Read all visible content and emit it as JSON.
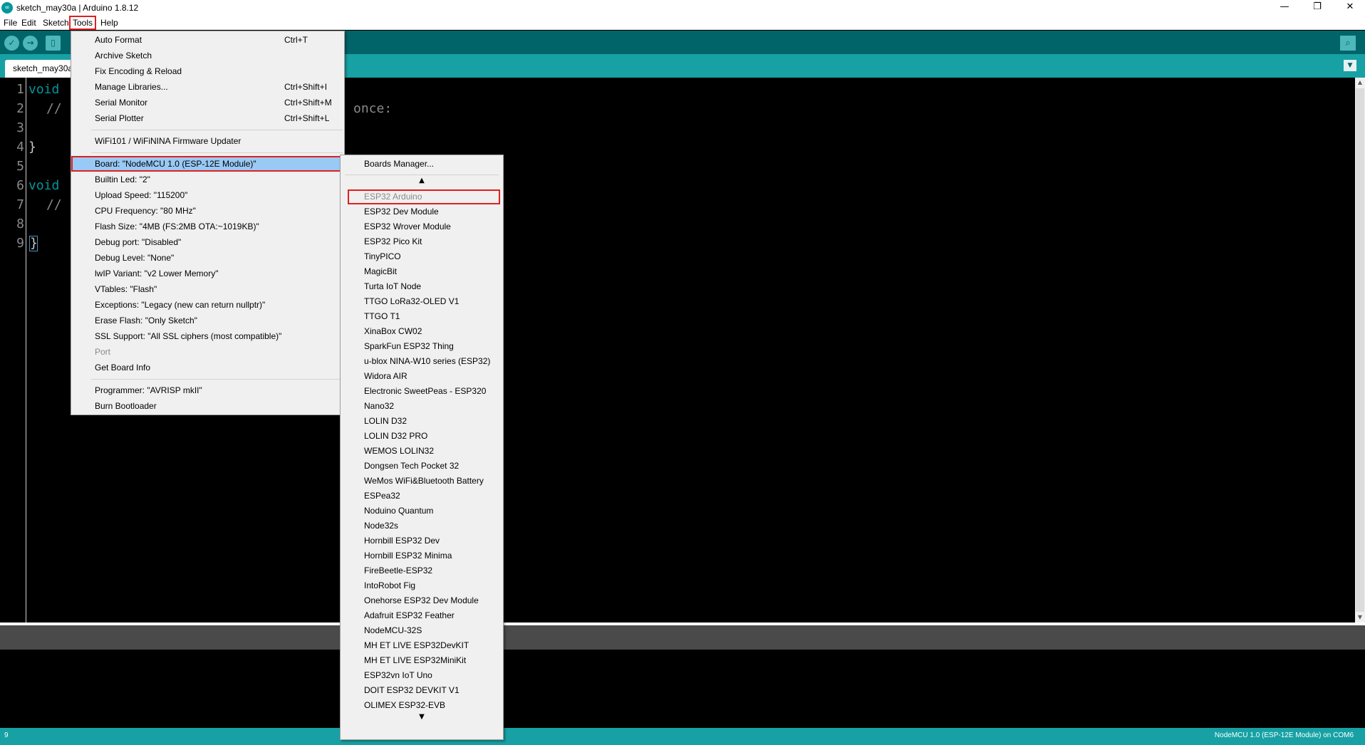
{
  "window": {
    "title": "sketch_may30a | Arduino 1.8.12",
    "logo_glyph": "∞",
    "controls": {
      "minimize": "—",
      "maximize": "❐",
      "close": "✕"
    }
  },
  "menubar": [
    "File",
    "Edit",
    "Sketch",
    "Tools",
    "Help"
  ],
  "toolbar": {
    "verify_icon": "✓",
    "upload_icon": "→",
    "new_icon": "▯",
    "serial_monitor_icon": "⌕"
  },
  "tab": {
    "name": "sketch_may30a",
    "menu_icon": "▼"
  },
  "editor": {
    "line_numbers": [
      "1",
      "2",
      "3",
      "4",
      "5",
      "6",
      "7",
      "8",
      "9"
    ],
    "lines": {
      "l1": "void",
      "l2": "//",
      "l2_tail": "once:",
      "l4": "}",
      "l6": "void",
      "l7": "//",
      "l9": "}"
    }
  },
  "tools_menu": {
    "items": [
      {
        "label": "Auto Format",
        "shortcut": "Ctrl+T"
      },
      {
        "label": "Archive Sketch",
        "shortcut": ""
      },
      {
        "label": "Fix Encoding & Reload",
        "shortcut": ""
      },
      {
        "label": "Manage Libraries...",
        "shortcut": "Ctrl+Shift+I"
      },
      {
        "label": "Serial Monitor",
        "shortcut": "Ctrl+Shift+M"
      },
      {
        "label": "Serial Plotter",
        "shortcut": "Ctrl+Shift+L"
      },
      {
        "label": "WiFi101 / WiFiNINA Firmware Updater",
        "shortcut": ""
      },
      {
        "label": "Board: \"NodeMCU 1.0 (ESP-12E Module)\"",
        "shortcut": ""
      },
      {
        "label": "Builtin Led: \"2\"",
        "shortcut": ""
      },
      {
        "label": "Upload Speed: \"115200\"",
        "shortcut": ""
      },
      {
        "label": "CPU Frequency: \"80 MHz\"",
        "shortcut": ""
      },
      {
        "label": "Flash Size: \"4MB (FS:2MB OTA:~1019KB)\"",
        "shortcut": ""
      },
      {
        "label": "Debug port: \"Disabled\"",
        "shortcut": ""
      },
      {
        "label": "Debug Level: \"None\"",
        "shortcut": ""
      },
      {
        "label": "lwIP Variant: \"v2 Lower Memory\"",
        "shortcut": ""
      },
      {
        "label": "VTables: \"Flash\"",
        "shortcut": ""
      },
      {
        "label": "Exceptions: \"Legacy (new can return nullptr)\"",
        "shortcut": ""
      },
      {
        "label": "Erase Flash: \"Only Sketch\"",
        "shortcut": ""
      },
      {
        "label": "SSL Support: \"All SSL ciphers (most compatible)\"",
        "shortcut": ""
      },
      {
        "label": "Port",
        "shortcut": ""
      },
      {
        "label": "Get Board Info",
        "shortcut": ""
      },
      {
        "label": "Programmer: \"AVRISP mkII\"",
        "shortcut": ""
      },
      {
        "label": "Burn Bootloader",
        "shortcut": ""
      }
    ],
    "submenu_arrow": "›"
  },
  "board_submenu": {
    "manager": "Boards Manager...",
    "scroll_up": "▲",
    "scroll_down": "▼",
    "boards": [
      "ESP32 Arduino",
      "ESP32 Dev Module",
      "ESP32 Wrover Module",
      "ESP32 Pico Kit",
      "TinyPICO",
      "MagicBit",
      "Turta IoT Node",
      "TTGO LoRa32-OLED V1",
      "TTGO T1",
      "XinaBox CW02",
      "SparkFun ESP32 Thing",
      "u-blox NINA-W10 series (ESP32)",
      "Widora AIR",
      "Electronic SweetPeas - ESP320",
      "Nano32",
      "LOLIN D32",
      "LOLIN D32 PRO",
      "WEMOS LOLIN32",
      "Dongsen Tech Pocket 32",
      "WeMos WiFi&Bluetooth Battery",
      "ESPea32",
      "Noduino Quantum",
      "Node32s",
      "Hornbill ESP32 Dev",
      "Hornbill ESP32 Minima",
      "FireBeetle-ESP32",
      "IntoRobot Fig",
      "Onehorse ESP32 Dev Module",
      "Adafruit ESP32 Feather",
      "NodeMCU-32S",
      "MH ET LIVE ESP32DevKIT",
      "MH ET LIVE ESP32MiniKit",
      "ESP32vn IoT Uno",
      "DOIT ESP32 DEVKIT V1",
      "OLIMEX ESP32-EVB"
    ]
  },
  "statusbar": {
    "line": "9",
    "board": "NodeMCU 1.0 (ESP-12E Module) on COM6"
  },
  "colors": {
    "toolbar": "#006468",
    "tabstrip": "#17a1a5",
    "keyword": "#00979c",
    "highlight_outline": "#e02020",
    "menu_selected": "#99c9f5"
  }
}
